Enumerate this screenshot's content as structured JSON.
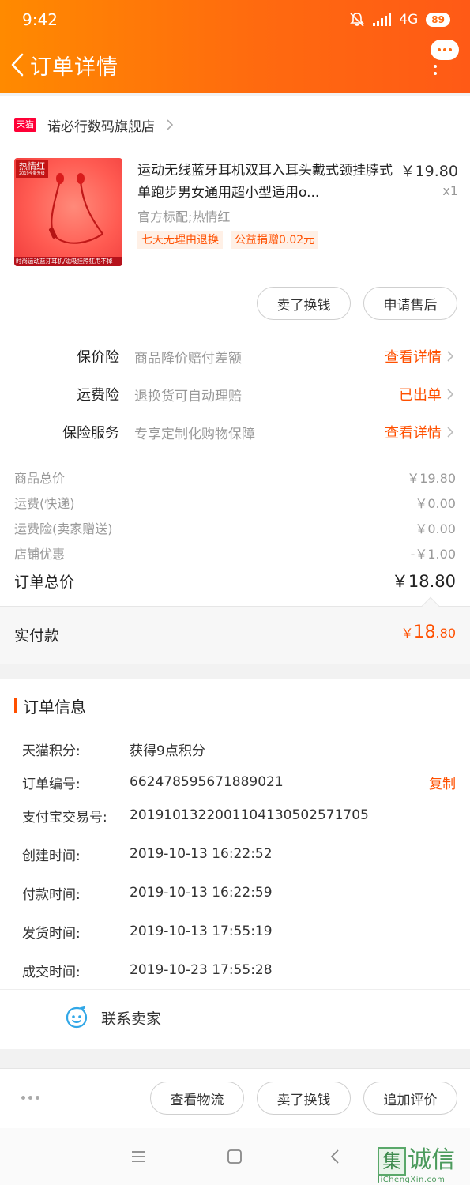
{
  "status_bar": {
    "time": "9:42",
    "network": "4G",
    "battery": "89"
  },
  "header": {
    "title": "订单详情"
  },
  "store": {
    "badge": "天猫",
    "name": "诺必行数码旗舰店"
  },
  "product": {
    "image_tag": "热情红",
    "image_tag_small": "2019全新升级",
    "image_caption": "时尚运动蓝牙耳机/磁吸挂脖狂甩不掉",
    "title": "运动无线蓝牙耳机双耳入耳头戴式颈挂脖式单跑步男女通用超小型适用o...",
    "price": "￥19.80",
    "qty": "x1",
    "spec": "官方标配;热情红",
    "tags": [
      "七天无理由退换",
      "公益捐赠0.02元"
    ]
  },
  "product_actions": {
    "sell": "卖了换钱",
    "after_sale": "申请售后"
  },
  "services": [
    {
      "label": "保价险",
      "desc": "商品降价赔付差额",
      "action": "查看详情"
    },
    {
      "label": "运费险",
      "desc": "退换货可自动理赔",
      "action": "已出单"
    },
    {
      "label": "保险服务",
      "desc": "专享定制化购物保障",
      "action": "查看详情"
    }
  ],
  "summary": [
    {
      "label": "商品总价",
      "value": "￥19.80"
    },
    {
      "label": "运费(快递)",
      "value": "￥0.00"
    },
    {
      "label": "运费险(卖家赠送)",
      "value": "￥0.00"
    },
    {
      "label": "店铺优惠",
      "value": "-￥1.00"
    }
  ],
  "order_total": {
    "label": "订单总价",
    "value": "￥18.80"
  },
  "paid": {
    "label": "实付款",
    "currency": "￥",
    "int": "18",
    "dec": ".80"
  },
  "order_info": {
    "title": "订单信息",
    "rows": [
      {
        "key": "天猫积分:",
        "value": "获得9点积分"
      },
      {
        "key": "订单编号:",
        "value": "662478595671889021",
        "action": "复制"
      },
      {
        "key": "支付宝交易号:",
        "value": "2019101322001104130502571705"
      },
      {
        "key": "创建时间:",
        "value": "2019-10-13 16:22:52"
      },
      {
        "key": "付款时间:",
        "value": "2019-10-13 16:22:59"
      },
      {
        "key": "发货时间:",
        "value": "2019-10-13 17:55:19"
      },
      {
        "key": "成交时间:",
        "value": "2019-10-23 17:55:28"
      }
    ]
  },
  "contact": {
    "label": "联系卖家"
  },
  "bottom_actions": {
    "logistics": "查看物流",
    "sell": "卖了换钱",
    "review": "追加评价"
  },
  "watermark": {
    "char": "集",
    "text": "诚信",
    "url": "JiChengXin.com"
  },
  "colors": {
    "accent": "#ff5000",
    "header_start": "#ff8a00",
    "header_end": "#ff5a16"
  }
}
